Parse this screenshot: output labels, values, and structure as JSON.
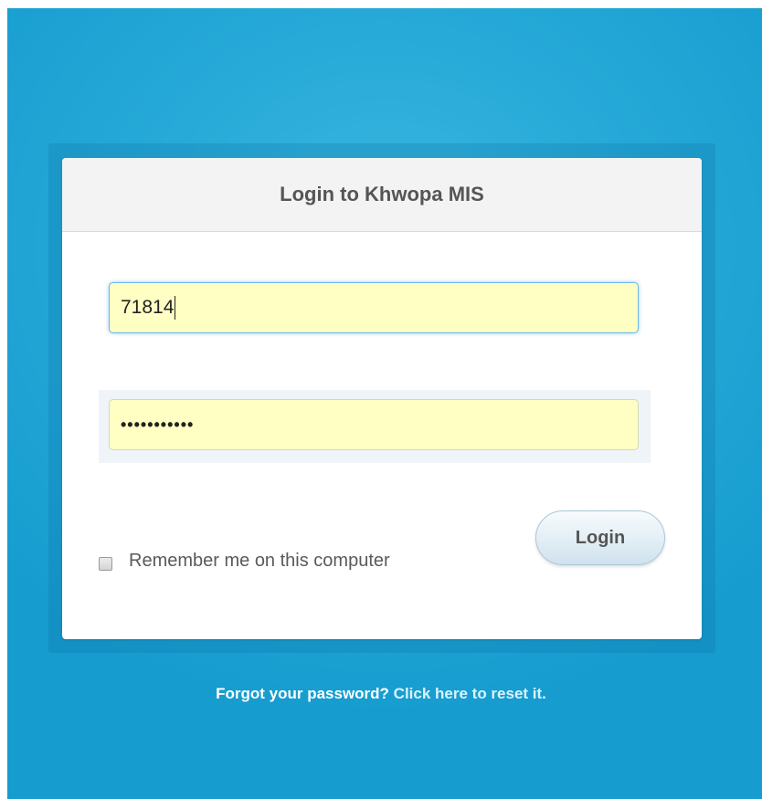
{
  "login": {
    "title": "Login to Khwopa MIS",
    "username_value": "71814",
    "password_masked": "•••••••••••",
    "login_button": "Login",
    "remember_label": "Remember me on this computer",
    "remember_checked": false
  },
  "footer": {
    "forgot_text": "Forgot your password?",
    "reset_link": "Click here to reset it."
  },
  "colors": {
    "background": "#27aad8",
    "field_fill": "#ffffc4",
    "header_fill": "#f3f3f3"
  }
}
